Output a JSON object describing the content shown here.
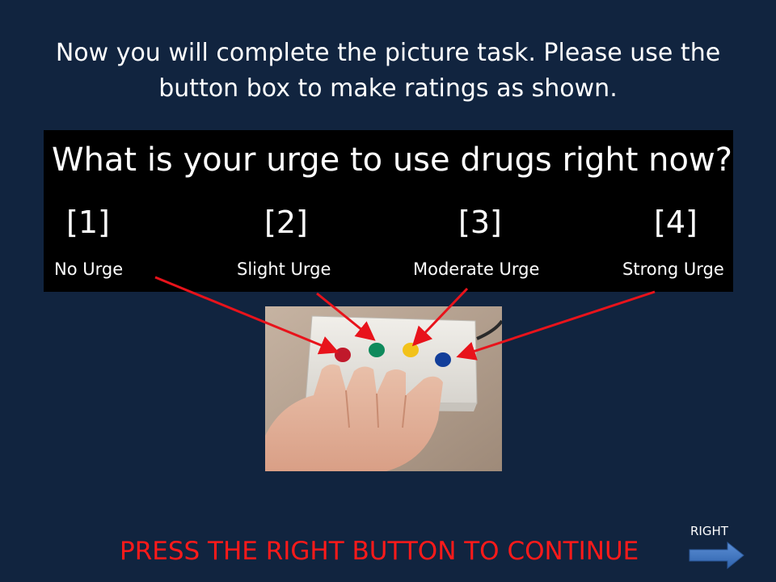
{
  "instructions": {
    "line1": "Now you will complete the picture task. Please use the",
    "line2": "button box to make ratings as shown."
  },
  "rating_panel": {
    "question": "What is your urge to use drugs right now?",
    "options": [
      {
        "number": "[1]",
        "label": "No Urge",
        "button_color": "#c0192b"
      },
      {
        "number": "[2]",
        "label": "Slight Urge",
        "button_color": "#0f8a5c"
      },
      {
        "number": "[3]",
        "label": "Moderate Urge",
        "button_color": "#f2c21a"
      },
      {
        "number": "[4]",
        "label": "Strong Urge",
        "button_color": "#123e9a"
      }
    ]
  },
  "photo": {
    "icon": "button-box-photo-icon"
  },
  "footer": {
    "continue_text": "PRESS THE RIGHT BUTTON TO CONTINUE",
    "right_label": "RIGHT",
    "right_arrow_icon": "right-arrow-icon"
  },
  "colors": {
    "background": "#11243f",
    "arrow_red": "#e8131b",
    "continue_red": "#ff1a1a",
    "nav_arrow_blue": "#3f77c6"
  }
}
